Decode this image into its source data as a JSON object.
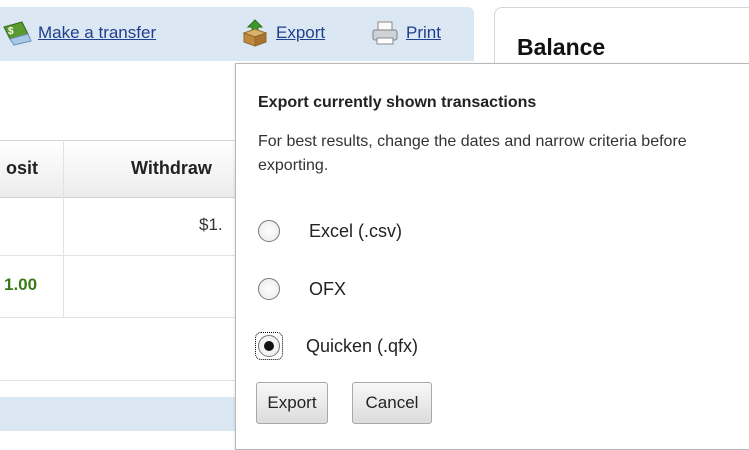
{
  "toolbar": {
    "transfer_label": "Make a transfer",
    "export_label": "Export",
    "print_label": "Print"
  },
  "balance": {
    "title": "Balance"
  },
  "table": {
    "headers": [
      "osit",
      "Withdraw"
    ],
    "rows": [
      {
        "withdrawal": "$1."
      },
      {
        "deposit": "1.00"
      }
    ]
  },
  "export_popup": {
    "title": "Export currently shown transactions",
    "description": "For best results, change the dates and narrow criteria before exporting.",
    "options": [
      {
        "label": "Excel (.csv)",
        "checked": false
      },
      {
        "label": "OFX",
        "checked": false
      },
      {
        "label": "Quicken (.qfx)",
        "checked": true
      }
    ],
    "export_button": "Export",
    "cancel_button": "Cancel"
  },
  "colors": {
    "toolbar_bg": "#dbe7f3",
    "link": "#1f3f8f",
    "deposit_green": "#3a7a17"
  },
  "icons": [
    "money-transfer-icon",
    "export-box-icon",
    "printer-icon"
  ]
}
